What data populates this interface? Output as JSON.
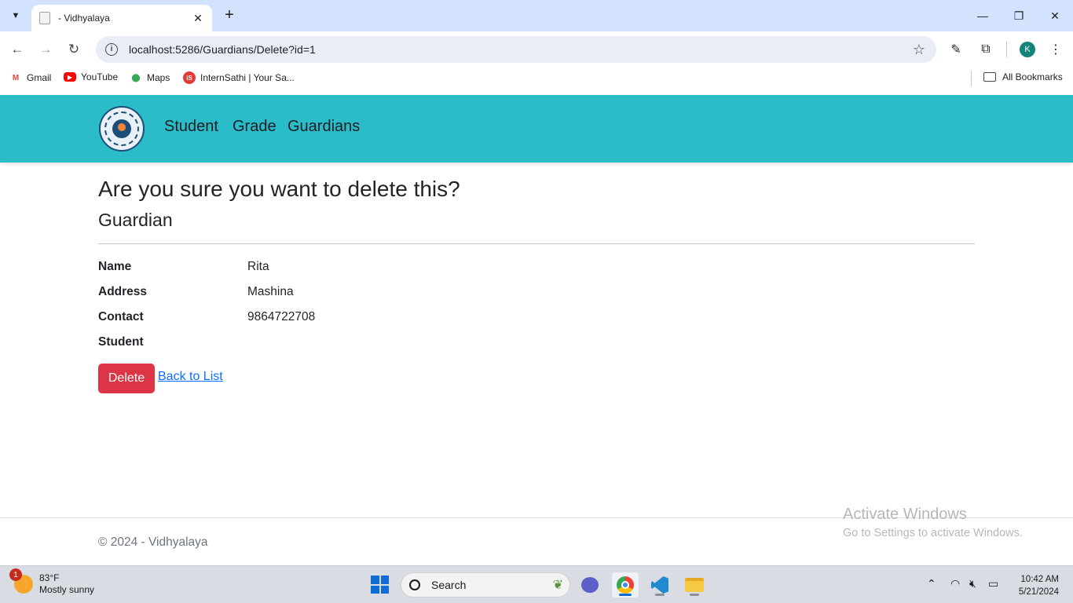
{
  "browser": {
    "tab_title": "- Vidhyalaya",
    "tab_close": "✕",
    "new_tab": "+",
    "url": "localhost:5286/Guardians/Delete?id=1",
    "profile_initial": "K",
    "bookmarks": [
      {
        "label": "Gmail",
        "icon": "gmail-icon"
      },
      {
        "label": "YouTube",
        "icon": "youtube-icon"
      },
      {
        "label": "Maps",
        "icon": "maps-icon"
      },
      {
        "label": "InternSathi | Your Sa...",
        "icon": "internsathi-icon"
      }
    ],
    "all_bookmarks": "All Bookmarks"
  },
  "site": {
    "nav": [
      "Student",
      "Grade",
      "Guardians"
    ],
    "brand_color": "#2bbcc9"
  },
  "page": {
    "heading": "Are you sure you want to delete this?",
    "subheading": "Guardian",
    "fields": [
      {
        "label": "Name",
        "value": "Rita"
      },
      {
        "label": "Address",
        "value": "Mashina"
      },
      {
        "label": "Contact",
        "value": "9864722708"
      },
      {
        "label": "Student",
        "value": ""
      }
    ],
    "delete_button": "Delete",
    "delete_color": "#dc3545",
    "back_link": "Back to List"
  },
  "footer": {
    "text": "© 2024 - Vidhyalaya"
  },
  "watermark": {
    "title": "Activate Windows",
    "subtitle": "Go to Settings to activate Windows."
  },
  "taskbar": {
    "weather_temp": "83°F",
    "weather_desc": "Mostly sunny",
    "weather_badge": "1",
    "search_placeholder": "Search",
    "time": "10:42 AM",
    "date": "5/21/2024"
  }
}
